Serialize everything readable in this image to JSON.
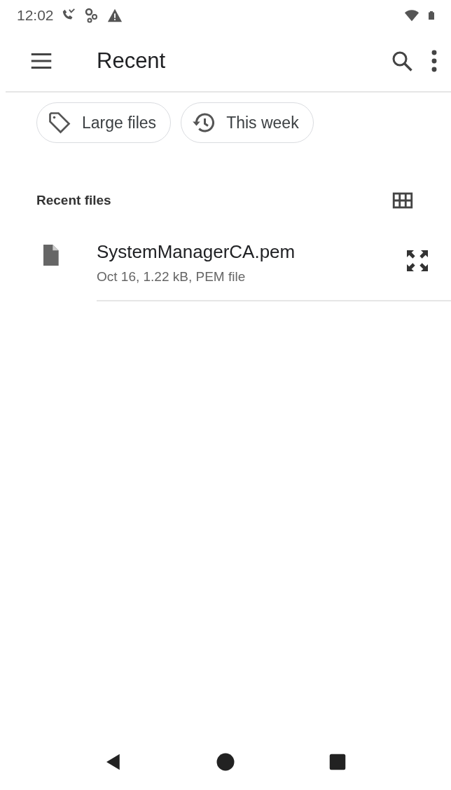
{
  "status_bar": {
    "time": "12:02"
  },
  "toolbar": {
    "title": "Recent"
  },
  "chips": [
    {
      "label": "Large files",
      "kind": "tag",
      "selected": false
    },
    {
      "label": "This week",
      "kind": "history",
      "selected": false
    }
  ],
  "section": {
    "title": "Recent files"
  },
  "files": [
    {
      "name": "SystemManagerCA.pem",
      "details": "Oct 16, 1.22 kB, PEM file"
    }
  ]
}
